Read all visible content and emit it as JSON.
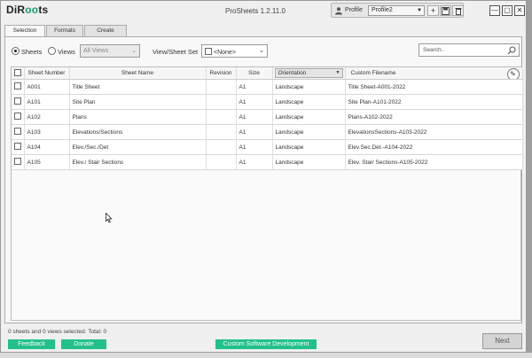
{
  "app": {
    "logo_left": "DiR",
    "logo_mid": "oo",
    "logo_right": "ts",
    "title": "ProSheets 1.2.11.0"
  },
  "profile": {
    "label": "Profile",
    "selected": "Profile2",
    "add_glyph": "+",
    "save_glyph": "▣",
    "delete_glyph": "🗑"
  },
  "window_controls": {
    "minimize": "—",
    "maximize": "▢",
    "close": "✕"
  },
  "tabs": [
    {
      "label": "Selection",
      "active": true
    },
    {
      "label": "Formats",
      "active": false
    },
    {
      "label": "Create",
      "active": false
    }
  ],
  "filters": {
    "sheets_label": "Sheets",
    "views_label": "Views",
    "views_combo": "All Views",
    "set_label": "View/Sheet Set",
    "set_combo": "<None>",
    "search_placeholder": "Search.."
  },
  "table": {
    "headers": [
      "Sheet Number",
      "Sheet Name",
      "Revision",
      "Size",
      "Orientation",
      "Custom Filename"
    ],
    "rows": [
      {
        "number": "A001",
        "name": "Title Sheet",
        "revision": "",
        "size": "A1",
        "orientation": "Landscape",
        "filename": "Title Sheet-A001-2022"
      },
      {
        "number": "A101",
        "name": "Site Plan",
        "revision": "",
        "size": "A1",
        "orientation": "Landscape",
        "filename": "Site Plan-A101-2022"
      },
      {
        "number": "A102",
        "name": "Plans",
        "revision": "",
        "size": "A1",
        "orientation": "Landscape",
        "filename": "Plans-A102-2022"
      },
      {
        "number": "A103",
        "name": "Elevations/Sections",
        "revision": "",
        "size": "A1",
        "orientation": "Landscape",
        "filename": "ElevationsSections-A103-2022"
      },
      {
        "number": "A104",
        "name": "Elev./Sec./Det",
        "revision": "",
        "size": "A1",
        "orientation": "Landscape",
        "filename": "Elev.Sec.Det.-A104-2022"
      },
      {
        "number": "A105",
        "name": "Elev./ Stair Sections",
        "revision": "",
        "size": "A1",
        "orientation": "Landscape",
        "filename": "Elev. Stair Sections-A105-2022"
      }
    ]
  },
  "footer": {
    "status": "0 sheets and 0 views selected. Total: 0",
    "feedback": "Feedback",
    "donate": "Donate",
    "custom_dev": "Custom Software Development",
    "next": "Next"
  },
  "colors": {
    "accent": "#22c08a",
    "logo_accent": "#1a9e76"
  }
}
